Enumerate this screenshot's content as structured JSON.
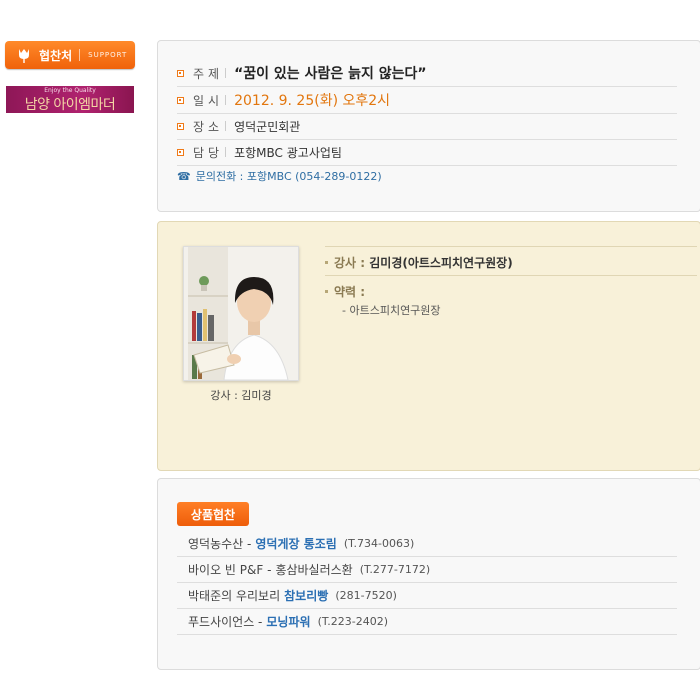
{
  "sidebar": {
    "support_label": "협찬처",
    "support_sub": "SUPPORT",
    "sponsor_tagline": "Enjoy the Quality",
    "sponsor_name": "남양 아이엠마더"
  },
  "event": {
    "rows": [
      {
        "label": "주제",
        "value": "“꿈이 있는 사람은 늙지 않는다”"
      },
      {
        "label": "일시",
        "value": "2012. 9. 25(화) 오후2시"
      },
      {
        "label": "장소",
        "value": "영덕군민회관"
      },
      {
        "label": "담당",
        "value": "포항MBC 광고사업팀"
      }
    ],
    "contact": "문의전화 : 포항MBC (054-289-0122)"
  },
  "lecturer": {
    "caption": "강사 : 김미경",
    "name_key": "강사 :",
    "name_value": "김미경(아트스피치연구원장)",
    "career_label": "약력 :",
    "career_item": "- 아트스피치연구원장"
  },
  "products": {
    "badge": "상품협찬",
    "items": [
      {
        "company": "영덕농수산 -",
        "product": "영덕게장 통조림",
        "phone": "(T.734-0063)"
      },
      {
        "company": "바이오 빈 P&F -",
        "product": "홍삼바실러스환",
        "phone": "(T.277-7172)"
      },
      {
        "company": "박태준의 우리보리",
        "product": "참보리빵",
        "phone": "(281-7520)"
      },
      {
        "company": "푸드사이언스 -",
        "product": "모닝파워",
        "phone": "(T.223-2402)"
      }
    ]
  },
  "colors": {
    "accent": "#f07a18",
    "link": "#2b6fb3",
    "lecture_bg": "#f8f1d9"
  }
}
